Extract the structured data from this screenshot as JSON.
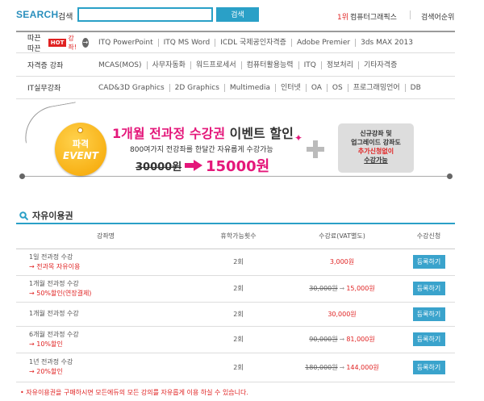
{
  "search": {
    "title": "SEARCH",
    "title_ko": "검색",
    "input_value": "",
    "button_label": "검색"
  },
  "ranking": {
    "number": "1위",
    "text": "컴퓨터그래픽스",
    "link_label": "검색어순위"
  },
  "categories": {
    "row1": {
      "label": "따끈따끈",
      "hot_badge": "HOT",
      "hot_text": "강좌!",
      "go_icon": "→",
      "items": [
        "ITQ PowerPoint",
        "ITQ MS Word",
        "ICDL 국제공인자격증",
        "Adobe Premier",
        "3ds MAX 2013"
      ]
    },
    "row2": {
      "label": "자격증 강좌",
      "items": [
        "MCAS(MOS)",
        "사무자동화",
        "워드프로세서",
        "컴퓨터활용능력",
        "ITQ",
        "정보처리",
        "기타자격증"
      ]
    },
    "row3": {
      "label": "IT실무강좌",
      "items": [
        "CAD&3D Graphics",
        "2D Graphics",
        "Multimedia",
        "인터넷",
        "OA",
        "OS",
        "프로그래밍언어",
        "DB"
      ]
    }
  },
  "banner": {
    "tag_top": "파격",
    "tag_bottom": "EVENT",
    "title_highlight": "1개월 전과정 수강권",
    "title_rest": " 이벤트 할인",
    "subtitle": "800여가지 전강좌를 한달간 자유롭게 수강가능",
    "price_old": "30000원",
    "price_new": "15000원",
    "promo_line1": "신규강좌 및",
    "promo_line2": "업그레이드 강좌도",
    "promo_line3": "추가신청없이",
    "promo_line4": "수강가능"
  },
  "section": {
    "title": "자유이용권",
    "headers": [
      "강좌명",
      "휴학가능횟수",
      "수강료(VAT별도)",
      "수강신청"
    ],
    "rows": [
      {
        "name": "1일 전과정 수강",
        "detail": "→ 전과목 자유이용",
        "count": "2회",
        "price_old": "",
        "price": "3,000원",
        "button": "등록하기"
      },
      {
        "name": "1개월 전과정 수강",
        "detail": "→ 50%할인(연장결제)",
        "count": "2회",
        "price_old": "30,000원",
        "price": "15,000원",
        "button": "등록하기"
      },
      {
        "name": "1개월 전과정 수강",
        "detail": "",
        "count": "2회",
        "price_old": "",
        "price": "30,000원",
        "button": "등록하기"
      },
      {
        "name": "6개월 전과정 수강",
        "detail": "→ 10%할인",
        "count": "2회",
        "price_old": "90,000원",
        "price": "81,000원",
        "button": "등록하기"
      },
      {
        "name": "1년 전과정 수강",
        "detail": "→ 20%할인",
        "count": "2회",
        "price_old": "180,000원",
        "price": "144,000원",
        "button": "등록하기"
      }
    ],
    "footnote": "• 자유이용권을 구매하시면 모든에듀의 모든 강의를 자유롭게 이용 하실 수 있습니다."
  },
  "colors": {
    "accent": "#2aa0c7",
    "highlight": "#e4177a",
    "red": "#e02222",
    "event_tag": "#f5a400"
  }
}
